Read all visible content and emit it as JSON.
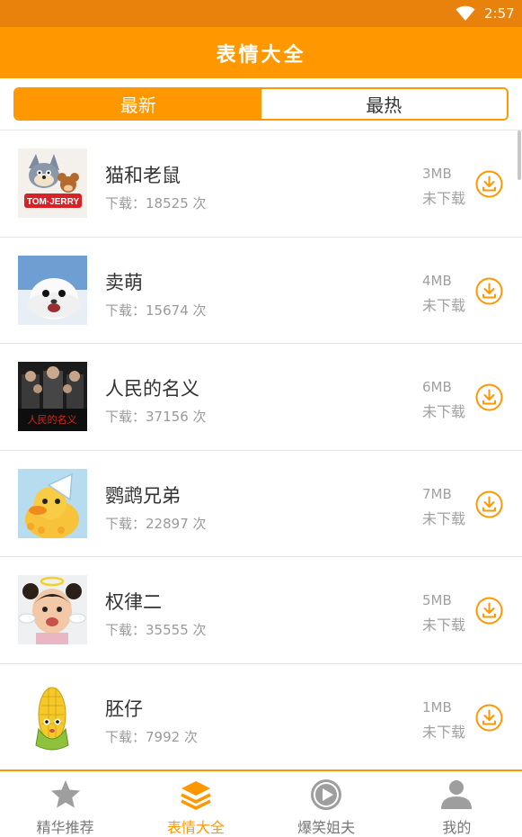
{
  "status_bar": {
    "time": "2:57",
    "icons": [
      "wifi-icon"
    ]
  },
  "header": {
    "title": "表情大全"
  },
  "tabs": [
    {
      "label": "最新",
      "active": true
    },
    {
      "label": "最热",
      "active": false
    }
  ],
  "list": {
    "download_prefix": "下载：",
    "download_suffix": " 次",
    "items": [
      {
        "name": "猫和老鼠",
        "downloads": "18525",
        "size": "3MB",
        "status": "未下载",
        "thumb": "tom-and-jerry"
      },
      {
        "name": "卖萌",
        "downloads": "15674",
        "size": "4MB",
        "status": "未下载",
        "thumb": "seal"
      },
      {
        "name": "人民的名义",
        "downloads": "37156",
        "size": "6MB",
        "status": "未下载",
        "thumb": "drama-poster"
      },
      {
        "name": "鹦鹉兄弟",
        "downloads": "22897",
        "size": "7MB",
        "status": "未下载",
        "thumb": "duck"
      },
      {
        "name": "权律二",
        "downloads": "35555",
        "size": "5MB",
        "status": "未下载",
        "thumb": "child-angel"
      },
      {
        "name": "胚仔",
        "downloads": "7992",
        "size": "1MB",
        "status": "未下载",
        "thumb": "corn"
      }
    ]
  },
  "bottom_nav": [
    {
      "label": "精华推荐",
      "icon": "star-icon",
      "active": false
    },
    {
      "label": "表情大全",
      "icon": "layers-icon",
      "active": true
    },
    {
      "label": "爆笑姐夫",
      "icon": "play-icon",
      "active": false
    },
    {
      "label": "我的",
      "icon": "person-icon",
      "active": false
    }
  ],
  "colors": {
    "accent": "#FF9800",
    "status_bar": "#E8820C",
    "text_primary": "#333333",
    "text_secondary": "#9A9A9A"
  }
}
